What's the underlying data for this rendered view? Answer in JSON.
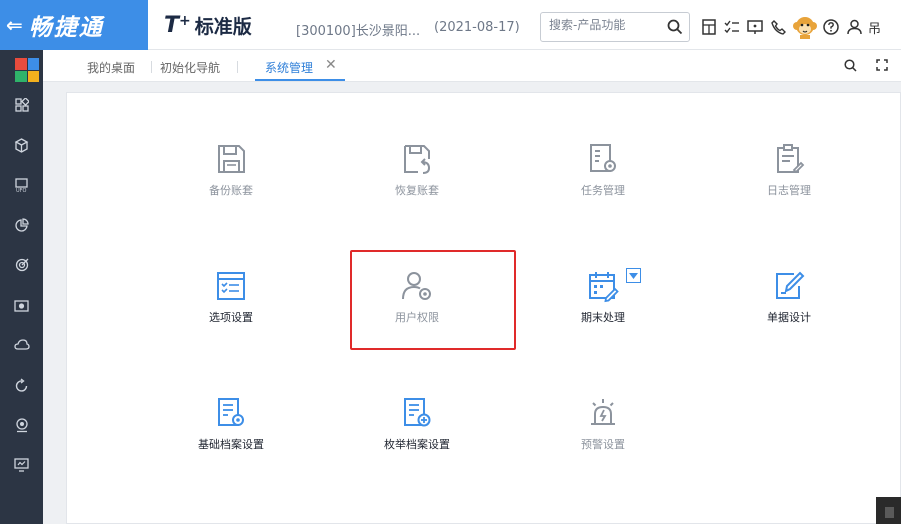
{
  "header": {
    "back_icon": "arrow-left-icon",
    "brand_name": "畅捷通",
    "edition_t": "T",
    "edition_plus": "+",
    "edition_name": "标准版",
    "account": "[300100]长沙景阳...",
    "date": "(2021-08-17)",
    "search_placeholder": "搜索-产品功能",
    "user_initial": "吊",
    "colors": {
      "brand": "#3d8ee7",
      "header_text": "#1c2a44"
    }
  },
  "tabs": {
    "items": [
      {
        "label": "我的桌面"
      },
      {
        "label": "初始化导航"
      },
      {
        "label": "系统管理"
      }
    ],
    "active_index": 2,
    "close_glyph": "✕"
  },
  "sidebar": {
    "logo_colors": [
      "#e84c3d",
      "#3d8ee7",
      "#2fb36a",
      "#f2b01e"
    ],
    "items": [
      {
        "icon": "apps-grid-icon"
      },
      {
        "icon": "cube-stack-icon"
      },
      {
        "icon": "ufo-report-icon"
      },
      {
        "icon": "pie-chart-icon"
      },
      {
        "icon": "target-icon"
      },
      {
        "icon": "camera-icon"
      },
      {
        "icon": "cloud-icon"
      },
      {
        "icon": "refresh-icon"
      },
      {
        "icon": "webcam-icon"
      },
      {
        "icon": "monitor-icon"
      }
    ]
  },
  "functions": [
    {
      "label": "备份账套",
      "icon": "save-disk-icon",
      "enabled": false
    },
    {
      "label": "恢复账套",
      "icon": "restore-disk-icon",
      "enabled": false
    },
    {
      "label": "任务管理",
      "icon": "task-settings-icon",
      "enabled": false
    },
    {
      "label": "日志管理",
      "icon": "log-clipboard-icon",
      "enabled": false
    },
    {
      "label": "选项设置",
      "icon": "options-checklist-icon",
      "enabled": true
    },
    {
      "label": "用户权限",
      "icon": "user-settings-icon",
      "enabled": false
    },
    {
      "label": "期末处理",
      "icon": "calendar-edit-icon",
      "enabled": true
    },
    {
      "label": "单据设计",
      "icon": "document-edit-icon",
      "enabled": true
    },
    {
      "label": "基础档案设置",
      "icon": "archive-settings-icon",
      "enabled": true
    },
    {
      "label": "枚举档案设置",
      "icon": "archive-add-icon",
      "enabled": true
    },
    {
      "label": "预警设置",
      "icon": "alarm-icon",
      "enabled": false
    }
  ],
  "colors": {
    "enabled_icon": "#3d8ee7",
    "disabled_icon": "#8c939d",
    "highlight": "#e02a2a"
  }
}
